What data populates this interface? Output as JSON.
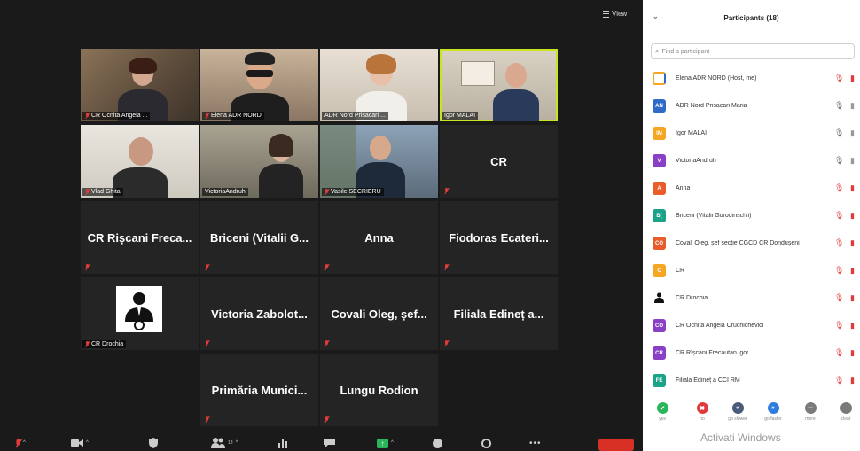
{
  "view_button": {
    "label": "View"
  },
  "tiles": [
    {
      "name": "CR Ocnita Angela ...",
      "muted": true,
      "video": true
    },
    {
      "name": "Elena ADR NORD",
      "muted": true,
      "video": true
    },
    {
      "name": "ADR Nord Prisacari ...",
      "muted": false,
      "video": true
    },
    {
      "name": "Igor MALAI",
      "muted": false,
      "video": true,
      "active": true
    },
    {
      "name": "Vlad Ghita",
      "muted": true,
      "video": true
    },
    {
      "name": "VictoriaAndruh",
      "muted": false,
      "video": true
    },
    {
      "name": "Vasile SECRIERU",
      "muted": true,
      "video": true
    },
    {
      "name": "CR",
      "muted": true,
      "video": false
    },
    {
      "name": "CR Rișcani Freca...",
      "muted": true,
      "video": false
    },
    {
      "name": "Briceni (Vitalii G...",
      "muted": true,
      "video": false
    },
    {
      "name": "Anna",
      "muted": true,
      "video": false
    },
    {
      "name": "Fiodoras Ecateri...",
      "muted": true,
      "video": false
    },
    {
      "name": "CR Drochia",
      "muted": true,
      "video": false,
      "logo": true
    },
    {
      "name": "Victoria Zabolot...",
      "muted": true,
      "video": false
    },
    {
      "name": "Covali Oleg, șef...",
      "muted": true,
      "video": false
    },
    {
      "name": "Filiala Edineț a...",
      "muted": true,
      "video": false
    },
    {
      "name": "Primăria Munici...",
      "muted": true,
      "video": false
    },
    {
      "name": "Lungu Rodion",
      "muted": true,
      "video": false
    }
  ],
  "panel": {
    "title": "Participants (18)",
    "search_placeholder": "Find a participant",
    "participants": [
      {
        "initials": "",
        "name": "Elena ADR NORD (Host, me)",
        "color": "#f5a623",
        "mic": "muted"
      },
      {
        "initials": "AN",
        "name": "ADR Nord Prisacari Maria",
        "color": "#2e6bc9",
        "mic": "on"
      },
      {
        "initials": "IM",
        "name": "Igor MALAI",
        "color": "#f5a623",
        "mic": "on"
      },
      {
        "initials": "V",
        "name": "VictoriaAndruh",
        "color": "#8a3fc7",
        "mic": "on"
      },
      {
        "initials": "A",
        "name": "Anna",
        "color": "#e85d2a",
        "mic": "muted"
      },
      {
        "initials": "B(",
        "name": "Briceni (Vitalii Gorodinschii)",
        "color": "#1aa389",
        "mic": "muted"
      },
      {
        "initials": "CO",
        "name": "Covali Oleg, șef secție CGCD CR Dondușeni",
        "color": "#e85d2a",
        "mic": "muted"
      },
      {
        "initials": "C",
        "name": "CR",
        "color": "#f5a623",
        "mic": "muted"
      },
      {
        "initials": "",
        "name": "CR Drochia",
        "color": "#222222",
        "mic": "muted"
      },
      {
        "initials": "CO",
        "name": "CR Ocnița Angela Cruchichevici",
        "color": "#8a3fc7",
        "mic": "muted"
      },
      {
        "initials": "CR",
        "name": "CR Rîșcani Frecautan igor",
        "color": "#8a3fc7",
        "mic": "muted"
      },
      {
        "initials": "FE",
        "name": "Filiala Edineț a CCI RM",
        "color": "#1aa389",
        "mic": "muted"
      }
    ],
    "reactions": [
      {
        "label": "yes",
        "color": "#2bb55b",
        "glyph": "✔"
      },
      {
        "label": "no",
        "color": "#e03a3a",
        "glyph": "✖"
      },
      {
        "label": "go slower",
        "color": "#4a5a7a",
        "glyph": "«"
      },
      {
        "label": "go faster",
        "color": "#2e7ce0",
        "glyph": "»"
      },
      {
        "label": "more",
        "color": "#7a7a7a",
        "glyph": "•••"
      },
      {
        "label": "clear",
        "color": "#7a7a7a",
        "glyph": ""
      }
    ]
  },
  "toolbar": {
    "participants_count": "18"
  },
  "watermark": "Activati Windows"
}
